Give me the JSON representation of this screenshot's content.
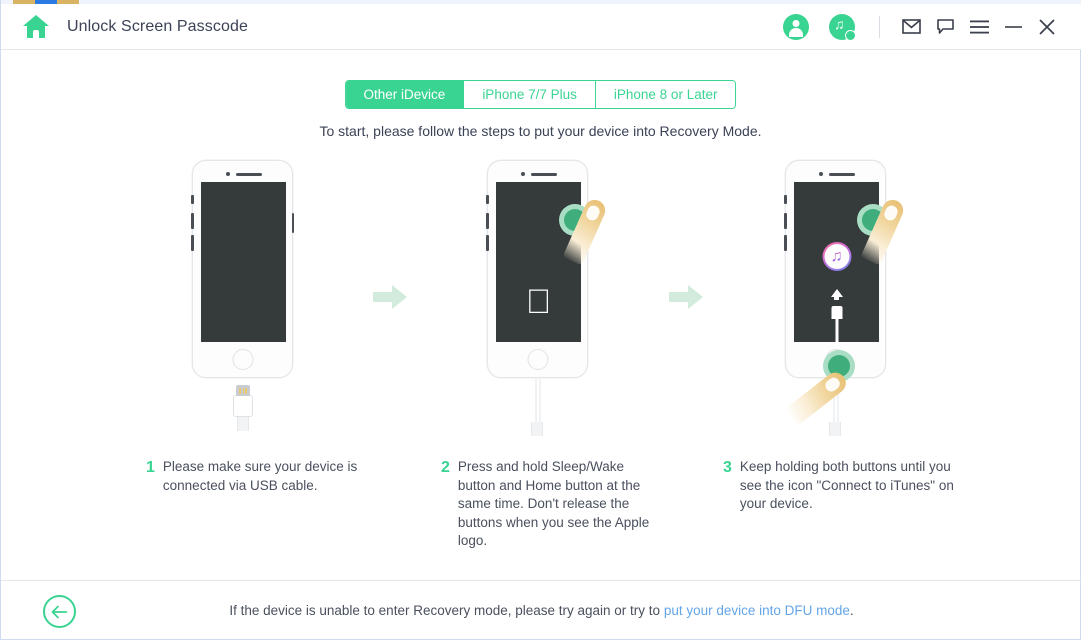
{
  "window": {
    "title": "Unlock Screen Passcode",
    "home_icon": "home-icon",
    "account_icon": "user-account-icon",
    "music_search_icon": "music-search-icon",
    "mail_icon": "mail-icon",
    "feedback_icon": "feedback-chat-icon",
    "menu_icon": "hamburger-menu-icon",
    "minimize_icon": "minimize-icon",
    "close_icon": "close-icon",
    "accent_color": "#3ad492",
    "link_color": "#63a6e8",
    "text_color": "#4a505e"
  },
  "tabs": [
    {
      "label": "Other iDevice",
      "active": true
    },
    {
      "label": "iPhone 7/7 Plus",
      "active": false
    },
    {
      "label": "iPhone 8 or Later",
      "active": false
    }
  ],
  "subtitle": "To start, please follow the steps to put your device into Recovery Mode.",
  "steps": [
    {
      "number": "1",
      "text": "Please make sure your device is connected via USB cable.",
      "screen": "blank-dark-screen"
    },
    {
      "number": "2",
      "text": "Press and hold Sleep/Wake button and Home button at the same time. Don't release the buttons when you see the Apple logo.",
      "screen": "apple-logo-screen"
    },
    {
      "number": "3",
      "text": "Keep holding both buttons until you see the icon \"Connect to iTunes\" on your device.",
      "screen": "connect-to-itunes-screen"
    }
  ],
  "footer": {
    "back_icon": "back-arrow-icon",
    "text_before": "If the device is unable to enter Recovery mode, please try again or try to ",
    "link_text": "put your device into DFU mode",
    "text_after": "."
  }
}
